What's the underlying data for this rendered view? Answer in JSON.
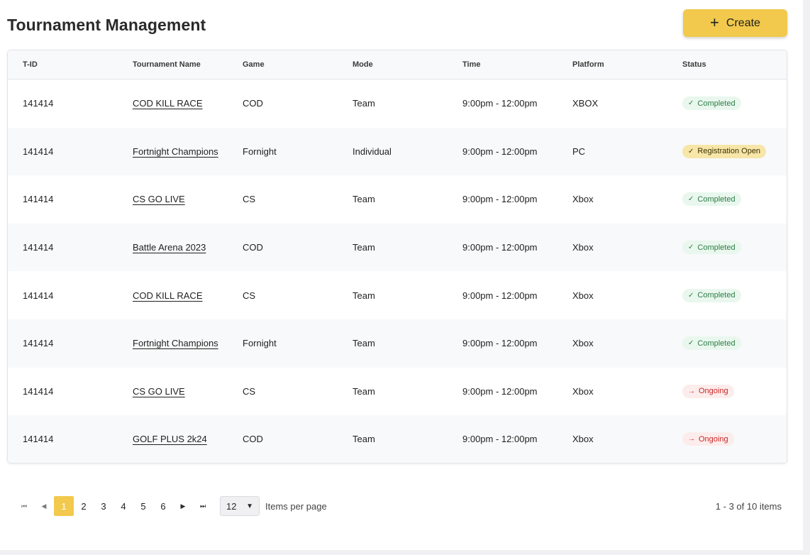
{
  "page": {
    "title": "Tournament Management",
    "create_label": "Create",
    "create_icon": "plus-icon"
  },
  "table": {
    "columns": [
      "T-ID",
      "Tournament Name",
      "Game",
      "Mode",
      "Time",
      "Platform",
      "Status"
    ],
    "rows": [
      {
        "tid": "141414",
        "name": "COD KILL RACE",
        "game": "COD",
        "mode": "Team",
        "time": "9:00pm - 12:00pm",
        "platform": "XBOX",
        "status": "Completed",
        "status_type": "completed"
      },
      {
        "tid": "141414",
        "name": "Fortnight Champions",
        "game": "Fornight",
        "mode": "Individual",
        "time": "9:00pm - 12:00pm",
        "platform": "PC",
        "status": "Registration Open",
        "status_type": "registration"
      },
      {
        "tid": "141414",
        "name": "CS GO LIVE",
        "game": "CS",
        "mode": "Team",
        "time": "9:00pm - 12:00pm",
        "platform": "Xbox",
        "status": "Completed",
        "status_type": "completed"
      },
      {
        "tid": "141414",
        "name": "Battle Arena 2023",
        "game": "COD",
        "mode": "Team",
        "time": "9:00pm - 12:00pm",
        "platform": "Xbox",
        "status": "Completed",
        "status_type": "completed"
      },
      {
        "tid": "141414",
        "name": "COD KILL RACE",
        "game": "CS",
        "mode": "Team",
        "time": "9:00pm - 12:00pm",
        "platform": "Xbox",
        "status": "Completed",
        "status_type": "completed"
      },
      {
        "tid": "141414",
        "name": "Fortnight Champions",
        "game": "Fornight",
        "mode": "Team",
        "time": "9:00pm - 12:00pm",
        "platform": "Xbox",
        "status": "Completed",
        "status_type": "completed"
      },
      {
        "tid": "141414",
        "name": "CS GO LIVE",
        "game": "CS",
        "mode": "Team",
        "time": "9:00pm - 12:00pm",
        "platform": "Xbox",
        "status": "Ongoing",
        "status_type": "ongoing"
      },
      {
        "tid": "141414",
        "name": "GOLF PLUS 2k24",
        "game": "COD",
        "mode": "Team",
        "time": "9:00pm - 12:00pm",
        "platform": "Xbox",
        "status": "Ongoing",
        "status_type": "ongoing"
      }
    ]
  },
  "status_icons": {
    "completed": "✓",
    "registration": "✓",
    "ongoing": "→"
  },
  "colors": {
    "accent": "#f2c94c",
    "completed_bg": "#e9f7ee",
    "completed_text": "#2e7d46",
    "registration_bg": "#f7e6a8",
    "ongoing_bg": "#fdecec",
    "ongoing_text": "#c62828"
  },
  "pagination": {
    "pages": [
      "1",
      "2",
      "3",
      "4",
      "5",
      "6"
    ],
    "current_page": "1",
    "per_page": "12",
    "per_page_label": "Items per page",
    "summary": "1 - 3 of 10 items"
  }
}
